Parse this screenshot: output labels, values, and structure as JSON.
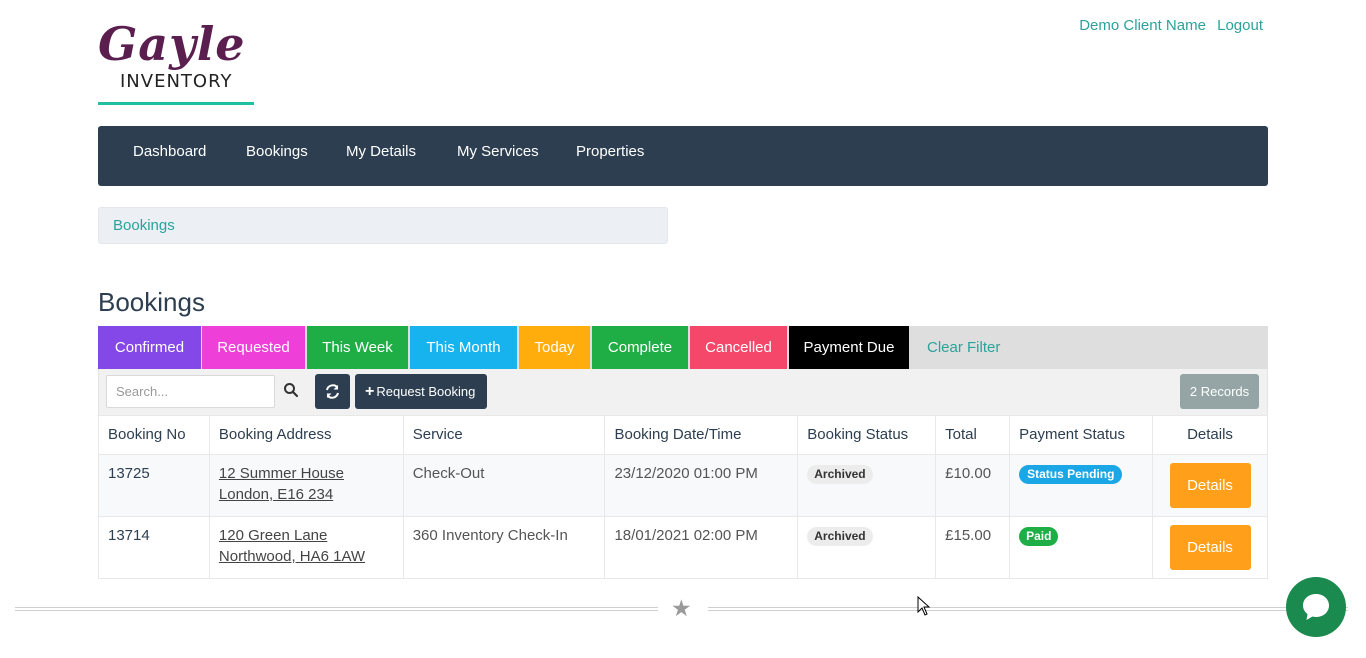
{
  "brand": {
    "script": "Gayle",
    "sub": "INVENTORY"
  },
  "top_links": {
    "user": "Demo Client Name",
    "logout": "Logout"
  },
  "nav": [
    "Dashboard",
    "Bookings",
    "My Details",
    "My Services",
    "Properties"
  ],
  "breadcrumb": "Bookings",
  "title": "Bookings",
  "filters": [
    {
      "label": "Confirmed",
      "color": "#8447e8"
    },
    {
      "label": "Requested",
      "color": "#ee3fd8"
    },
    {
      "label": "This Week",
      "color": "#1fad46"
    },
    {
      "label": "This Month",
      "color": "#17b3ee"
    },
    {
      "label": "Today",
      "color": "#ffad0d"
    },
    {
      "label": "Complete",
      "color": "#1fad46"
    },
    {
      "label": "Cancelled",
      "color": "#f5476a"
    },
    {
      "label": "Payment Due",
      "color": "#000000"
    }
  ],
  "clear_filter": "Clear Filter",
  "toolbar": {
    "search_placeholder": "Search...",
    "request_label": "Request Booking",
    "records": "2 Records"
  },
  "table": {
    "headers": [
      "Booking No",
      "Booking Address",
      "Service",
      "Booking Date/Time",
      "Booking Status",
      "Total",
      "Payment Status",
      "Details"
    ],
    "rows": [
      {
        "no": "13725",
        "addr1": "12 Summer House",
        "addr2": "London, E16 234",
        "service": "Check-Out",
        "datetime": "23/12/2020 01:00 PM",
        "status": "Archived",
        "total": "£10.00",
        "payment": "Status Pending",
        "details": "Details"
      },
      {
        "no": "13714",
        "addr1": "120 Green Lane",
        "addr2": "Northwood, HA6 1AW",
        "service": "360 Inventory Check-In",
        "datetime": "18/01/2021 02:00 PM",
        "status": "Archived",
        "total": "£15.00",
        "payment": "Paid",
        "details": "Details"
      }
    ]
  },
  "colors": {
    "navbar": "#2c3e50",
    "accent": "#2aa39a",
    "details": "#ff9f1a",
    "chat": "#1a8a4f"
  }
}
